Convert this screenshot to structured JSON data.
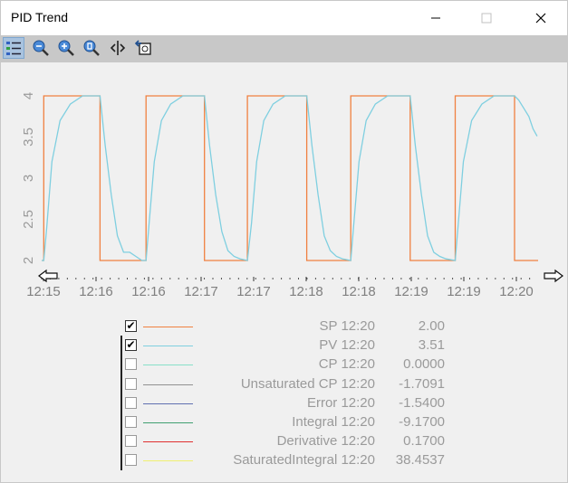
{
  "window": {
    "title": "PID Trend"
  },
  "toolbar": {
    "buttons": [
      {
        "name": "legend-toggle-icon",
        "active": true
      },
      {
        "name": "zoom-out-icon"
      },
      {
        "name": "zoom-in-icon"
      },
      {
        "name": "zoom-reset-icon"
      },
      {
        "name": "fit-width-icon"
      },
      {
        "name": "time-range-icon"
      }
    ]
  },
  "chart_data": {
    "type": "line",
    "ylim": [
      2,
      4
    ],
    "yticks": [
      "2",
      "2.5",
      "3",
      "3.5",
      "4"
    ],
    "xticks": [
      "12:15",
      "12:16",
      "12:16",
      "12:17",
      "12:17",
      "12:18",
      "12:18",
      "12:19",
      "12:19",
      "12:20"
    ],
    "colors": {
      "SP": "#f08040",
      "PV": "#7fcfe0"
    },
    "series": [
      {
        "name": "SP",
        "x": [
          0,
          0.02,
          0.02,
          0.57,
          0.57,
          1.02,
          1.02,
          1.59,
          1.59,
          2.01,
          2.01,
          2.59,
          2.59,
          3.02,
          3.02,
          3.6,
          3.6,
          4.04,
          4.04,
          4.62,
          4.62,
          4.85
        ],
        "values": [
          2,
          2,
          4,
          4,
          2,
          2,
          4,
          4,
          2,
          2,
          4,
          4,
          2,
          2,
          4,
          4,
          2,
          2,
          4,
          4,
          2,
          2
        ]
      },
      {
        "name": "PV",
        "x": [
          0,
          0.02,
          0.05,
          0.1,
          0.18,
          0.28,
          0.4,
          0.57,
          0.62,
          0.68,
          0.74,
          0.8,
          0.86,
          0.92,
          0.98,
          1.02,
          1.05,
          1.1,
          1.17,
          1.26,
          1.38,
          1.52,
          1.59,
          1.64,
          1.7,
          1.76,
          1.82,
          1.88,
          1.94,
          2.01,
          2.05,
          2.1,
          2.17,
          2.26,
          2.38,
          2.52,
          2.59,
          2.64,
          2.7,
          2.76,
          2.82,
          2.88,
          2.94,
          3.02,
          3.05,
          3.1,
          3.17,
          3.26,
          3.38,
          3.52,
          3.6,
          3.65,
          3.71,
          3.77,
          3.83,
          3.89,
          3.95,
          4.04,
          4.07,
          4.12,
          4.2,
          4.3,
          4.42,
          4.56,
          4.62,
          4.66,
          4.71,
          4.76,
          4.8,
          4.84
        ],
        "values": [
          2,
          2,
          2.4,
          3.2,
          3.7,
          3.9,
          4,
          4,
          3.4,
          2.8,
          2.3,
          2.1,
          2.1,
          2.05,
          2,
          2,
          2.45,
          3.2,
          3.7,
          3.9,
          4,
          4,
          4,
          3.4,
          2.8,
          2.35,
          2.12,
          2.05,
          2.02,
          2,
          2.45,
          3.2,
          3.7,
          3.9,
          4,
          4,
          4,
          3.4,
          2.8,
          2.3,
          2.12,
          2.05,
          2.02,
          2,
          2.45,
          3.2,
          3.7,
          3.9,
          4,
          4,
          4,
          3.4,
          2.8,
          2.3,
          2.1,
          2.05,
          2.02,
          2,
          2.45,
          3.2,
          3.7,
          3.9,
          4,
          4,
          4,
          3.95,
          3.85,
          3.75,
          3.6,
          3.51
        ]
      }
    ]
  },
  "legend": [
    {
      "checked": true,
      "label": "SP 12:20",
      "value": "2.00",
      "color": "#f08040"
    },
    {
      "checked": true,
      "label": "PV 12:20",
      "value": "3.51",
      "color": "#7fcfe0"
    },
    {
      "checked": false,
      "label": "CP 12:20",
      "value": "0.0000",
      "color": "#88e0c8"
    },
    {
      "checked": false,
      "label": "Unsaturated CP 12:20",
      "value": "-1.7091",
      "color": "#909090"
    },
    {
      "checked": false,
      "label": "Error 12:20",
      "value": "-1.5400",
      "color": "#6070b0"
    },
    {
      "checked": false,
      "label": "Integral 12:20",
      "value": "-9.1700",
      "color": "#40a070"
    },
    {
      "checked": false,
      "label": "Derivative 12:20",
      "value": "0.1700",
      "color": "#e03030"
    },
    {
      "checked": false,
      "label": "SaturatedIntegral 12:20",
      "value": "38.4537",
      "color": "#f0f070"
    }
  ]
}
